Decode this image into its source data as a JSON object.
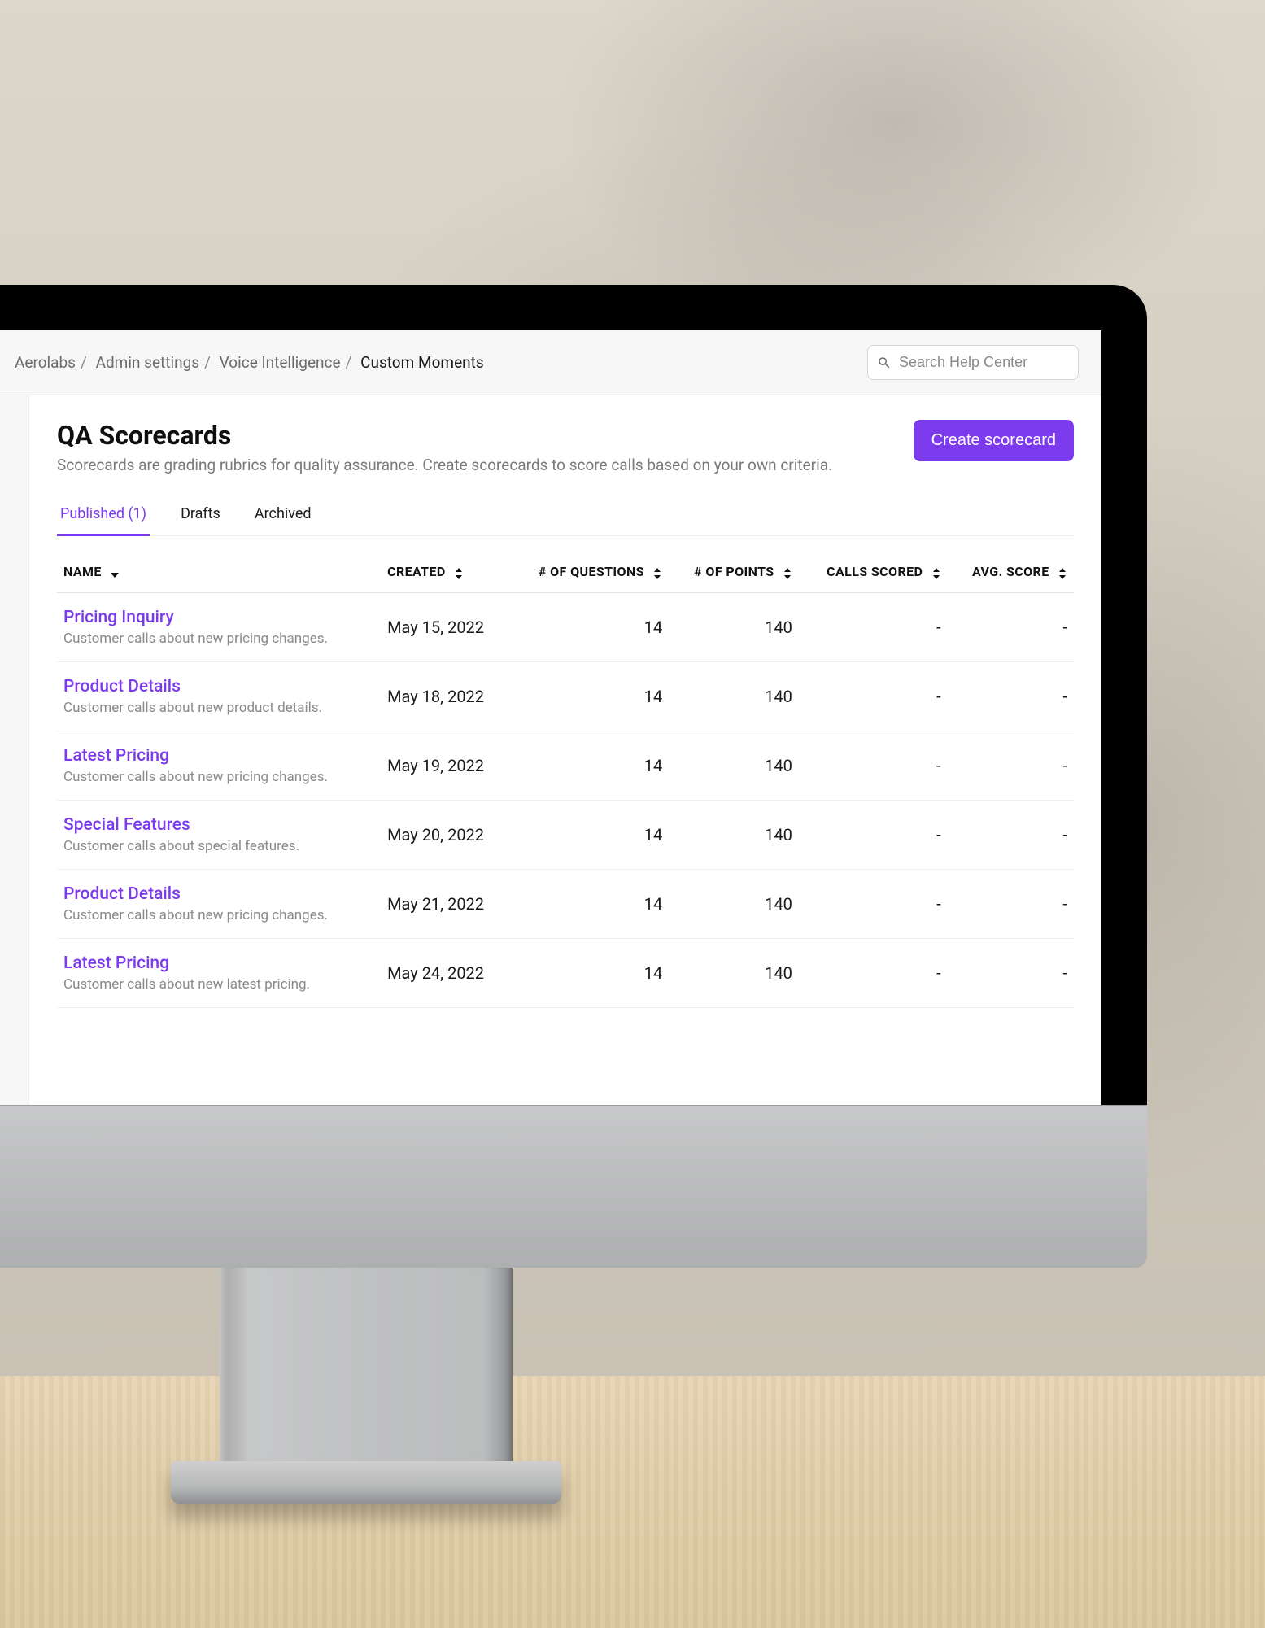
{
  "breadcrumb": {
    "items": [
      "Aerolabs",
      "Admin settings",
      "Voice Intelligence"
    ],
    "current": "Custom Moments"
  },
  "search": {
    "placeholder": "Search Help Center"
  },
  "header": {
    "title": "QA Scorecards",
    "description": "Scorecards are grading rubrics for quality assurance. Create scorecards to score calls based on your own criteria.",
    "create_label": "Create scorecard"
  },
  "tabs": [
    {
      "label": "Published (1)",
      "active": true
    },
    {
      "label": "Drafts",
      "active": false
    },
    {
      "label": "Archived",
      "active": false
    }
  ],
  "columns": {
    "name": "NAME",
    "created": "CREATED",
    "questions": "# OF QUESTIONS",
    "points": "# OF POINTS",
    "calls_scored": "CALLS SCORED",
    "avg_score": "AVG. SCORE"
  },
  "rows": [
    {
      "name": "Pricing Inquiry",
      "desc": "Customer calls about new pricing changes.",
      "created": "May 15, 2022",
      "questions": "14",
      "points": "140",
      "calls_scored": "-",
      "avg_score": "-"
    },
    {
      "name": "Product Details",
      "desc": "Customer calls about new product details.",
      "created": "May 18, 2022",
      "questions": "14",
      "points": "140",
      "calls_scored": "-",
      "avg_score": "-"
    },
    {
      "name": "Latest Pricing",
      "desc": "Customer calls about new pricing changes.",
      "created": "May 19, 2022",
      "questions": "14",
      "points": "140",
      "calls_scored": "-",
      "avg_score": "-"
    },
    {
      "name": "Special Features",
      "desc": "Customer calls about special features.",
      "created": "May 20, 2022",
      "questions": "14",
      "points": "140",
      "calls_scored": "-",
      "avg_score": "-"
    },
    {
      "name": "Product Details",
      "desc": "Customer calls about new pricing changes.",
      "created": "May 21, 2022",
      "questions": "14",
      "points": "140",
      "calls_scored": "-",
      "avg_score": "-"
    },
    {
      "name": "Latest Pricing",
      "desc": "Customer calls about new latest pricing.",
      "created": "May 24, 2022",
      "questions": "14",
      "points": "140",
      "calls_scored": "-",
      "avg_score": "-"
    }
  ]
}
